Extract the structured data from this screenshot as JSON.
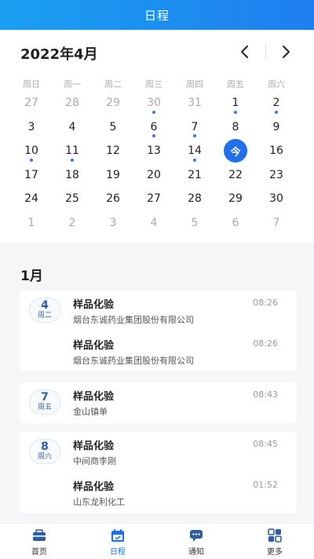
{
  "header": {
    "title": "日程"
  },
  "calendar": {
    "month_title": "2022年4月",
    "weekdays": [
      "周日",
      "周一",
      "周二",
      "周三",
      "周四",
      "周五",
      "周六"
    ],
    "weeks": [
      [
        {
          "d": "27",
          "m": true
        },
        {
          "d": "28",
          "m": true
        },
        {
          "d": "29",
          "m": true
        },
        {
          "d": "30",
          "m": true,
          "dot": true
        },
        {
          "d": "31",
          "m": true
        },
        {
          "d": "1",
          "dot": true
        },
        {
          "d": "2",
          "dot": true
        }
      ],
      [
        {
          "d": "3"
        },
        {
          "d": "4"
        },
        {
          "d": "5"
        },
        {
          "d": "6",
          "dot": true
        },
        {
          "d": "7",
          "dot": true
        },
        {
          "d": "8"
        },
        {
          "d": "9"
        }
      ],
      [
        {
          "d": "10",
          "dot": true
        },
        {
          "d": "11",
          "dot": true
        },
        {
          "d": "12"
        },
        {
          "d": "13"
        },
        {
          "d": "14",
          "dot": true
        },
        {
          "d": "今",
          "today": true
        },
        {
          "d": "16"
        }
      ],
      [
        {
          "d": "17"
        },
        {
          "d": "18"
        },
        {
          "d": "19"
        },
        {
          "d": "20"
        },
        {
          "d": "21"
        },
        {
          "d": "22"
        },
        {
          "d": "23"
        }
      ],
      [
        {
          "d": "24"
        },
        {
          "d": "25"
        },
        {
          "d": "26"
        },
        {
          "d": "27"
        },
        {
          "d": "28"
        },
        {
          "d": "29"
        },
        {
          "d": "30"
        }
      ],
      [
        {
          "d": "1",
          "m": true
        },
        {
          "d": "2",
          "m": true
        },
        {
          "d": "3",
          "m": true
        },
        {
          "d": "4",
          "m": true
        },
        {
          "d": "5",
          "m": true
        },
        {
          "d": "6",
          "m": true
        },
        {
          "d": "7",
          "m": true
        }
      ]
    ]
  },
  "schedule": {
    "month_label": "1月",
    "groups": [
      {
        "day": "4",
        "weekday": "周二",
        "items": [
          {
            "title": "样品化验",
            "sub": "烟台东诚药业集团股份有限公司",
            "time": "08:26"
          },
          {
            "title": "样品化验",
            "sub": "烟台东诚药业集团股份有限公司",
            "time": "08:26"
          }
        ]
      },
      {
        "day": "7",
        "weekday": "周五",
        "items": [
          {
            "title": "样品化验",
            "sub": "金山镇单",
            "time": "08:43"
          }
        ]
      },
      {
        "day": "8",
        "weekday": "周六",
        "items": [
          {
            "title": "样品化验",
            "sub": "中间商李刚",
            "time": "08:45"
          },
          {
            "title": "样品化验",
            "sub": "山东龙利化工",
            "time": "01:52"
          }
        ]
      }
    ]
  },
  "tabbar": {
    "tabs": [
      {
        "label": "首页",
        "icon": "home-icon"
      },
      {
        "label": "日程",
        "icon": "calendar-icon"
      },
      {
        "label": "通知",
        "icon": "message-icon"
      },
      {
        "label": "更多",
        "icon": "grid-icon"
      }
    ]
  },
  "colors": {
    "accent": "#1f6fef",
    "header_start": "#1aa0f0",
    "header_end": "#1f7ef0",
    "dot": "#3b78d8"
  }
}
